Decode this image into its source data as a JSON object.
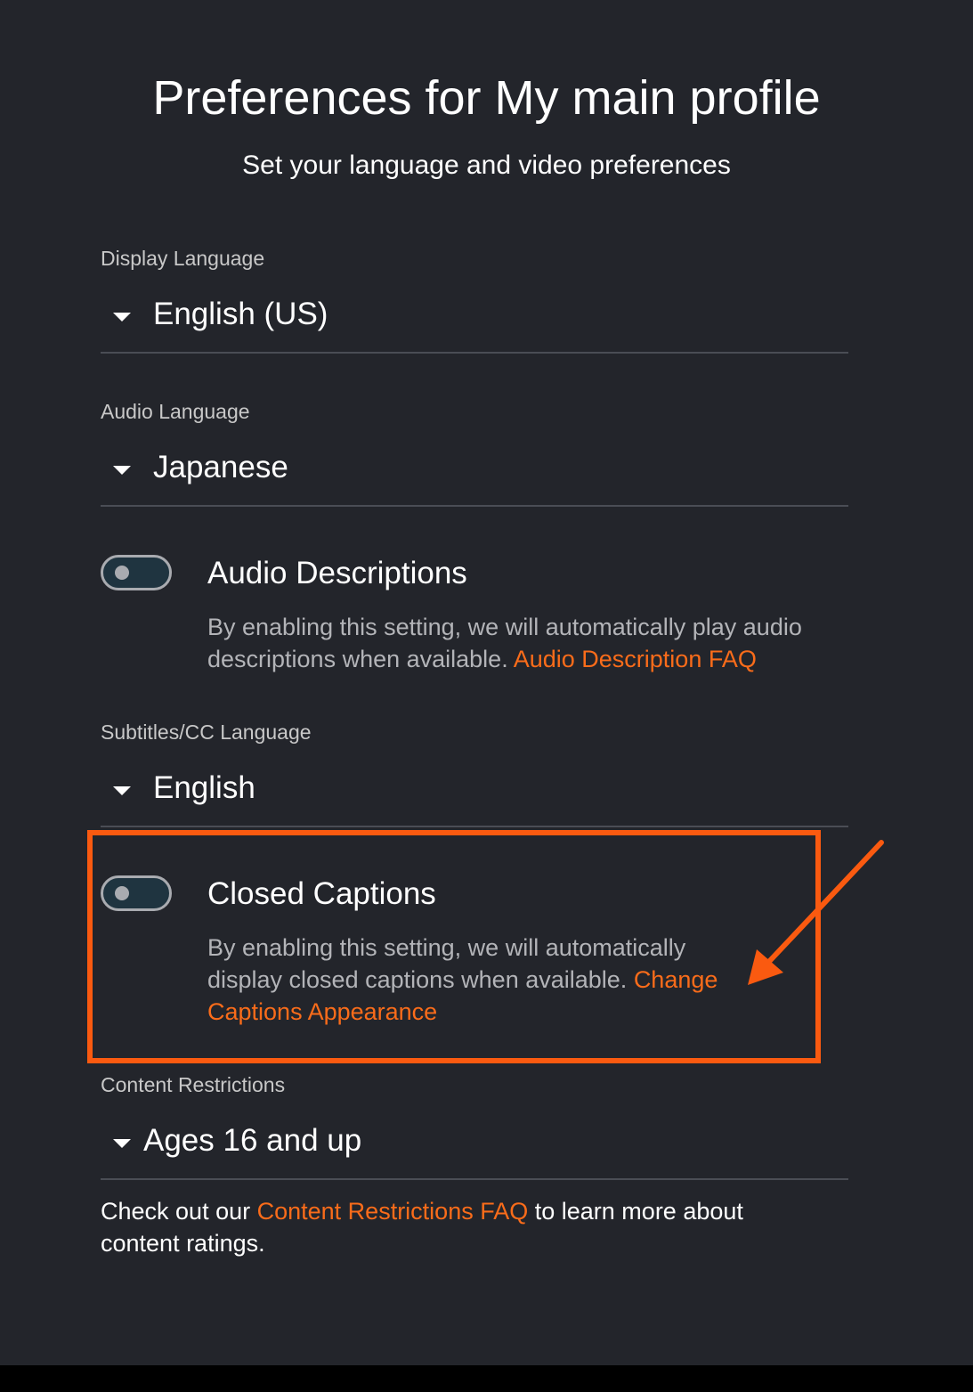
{
  "header": {
    "title": "Preferences for My main profile",
    "subtitle": "Set your language and video preferences"
  },
  "display_language": {
    "label": "Display Language",
    "value": "English (US)"
  },
  "audio_language": {
    "label": "Audio Language",
    "value": "Japanese"
  },
  "audio_descriptions": {
    "title": "Audio Descriptions",
    "enabled": false,
    "description": "By enabling this setting, we will automatically play audio descriptions when available.",
    "link": "Audio Description FAQ"
  },
  "subtitles_language": {
    "label": "Subtitles/CC Language",
    "value": "English"
  },
  "closed_captions": {
    "title": "Closed Captions",
    "enabled": false,
    "description": "By enabling this setting, we will automatically display closed captions when available.",
    "link": "Change Captions Appearance"
  },
  "content_restrictions": {
    "label": "Content Restrictions",
    "value": "Ages 16 and up"
  },
  "footer": {
    "prefix": "Check out our",
    "link": "Content Restrictions FAQ",
    "suffix": "to learn more about content ratings."
  },
  "colors": {
    "background": "#23252b",
    "accent": "#fa6c1a",
    "annotation": "#fa5a10"
  },
  "icons": {
    "dropdown": "caret-down-icon",
    "annotation": "arrow-icon"
  }
}
